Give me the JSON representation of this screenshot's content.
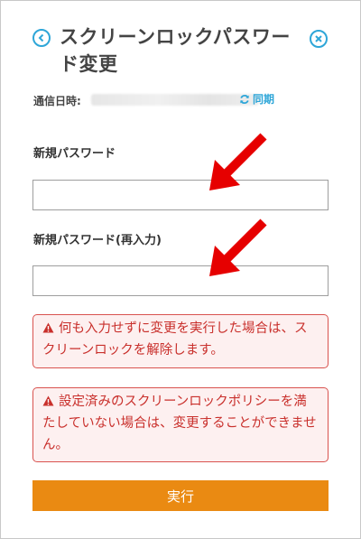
{
  "header": {
    "title": "スクリーンロックパスワード変更",
    "back_icon": "back-circle-icon",
    "close_icon": "close-circle-icon",
    "accent_color": "#2ea6d8"
  },
  "comm": {
    "label": "通信日時:",
    "sync_label": "同期",
    "sync_icon": "refresh-icon"
  },
  "form": {
    "new_password_label": "新規パスワード",
    "new_password_value": "",
    "confirm_password_label": "新規パスワード(再入力)",
    "confirm_password_value": ""
  },
  "alerts": [
    {
      "icon": "warning-icon",
      "text": "何も入力せずに変更を実行した場合は、スクリーンロックを解除します。"
    },
    {
      "icon": "warning-icon",
      "text": "設定済みのスクリーンロックポリシーを満たしていない場合は、変更することができません。"
    }
  ],
  "submit": {
    "label": "実行",
    "color": "#ea8a12"
  },
  "annotation_color": "#e60000"
}
